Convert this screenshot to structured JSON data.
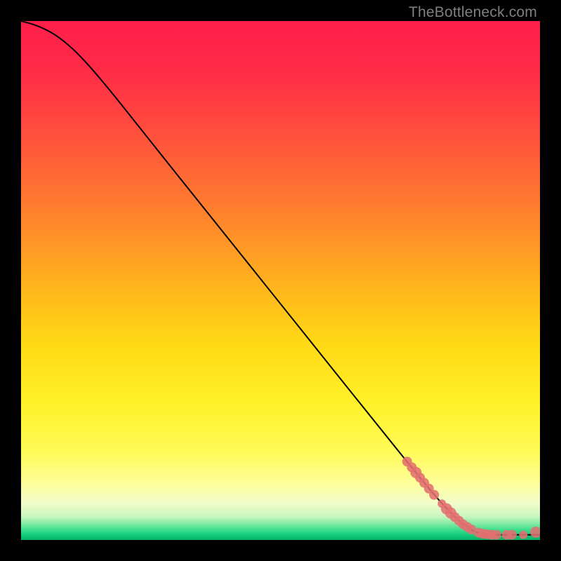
{
  "watermark": "TheBottleneck.com",
  "colors": {
    "point": "#e27070",
    "curve": "#000000",
    "gradient_stops": [
      {
        "offset": "0%",
        "color": "#ff1f4a"
      },
      {
        "offset": "9%",
        "color": "#ff2a47"
      },
      {
        "offset": "20%",
        "color": "#ff4a3e"
      },
      {
        "offset": "35%",
        "color": "#ff7a30"
      },
      {
        "offset": "50%",
        "color": "#ffb01e"
      },
      {
        "offset": "62%",
        "color": "#ffd915"
      },
      {
        "offset": "74%",
        "color": "#fff22a"
      },
      {
        "offset": "83%",
        "color": "#fffb58"
      },
      {
        "offset": "89%",
        "color": "#feff9a"
      },
      {
        "offset": "93%",
        "color": "#f1fcca"
      },
      {
        "offset": "95.5%",
        "color": "#c8f6c0"
      },
      {
        "offset": "97%",
        "color": "#7be9a0"
      },
      {
        "offset": "98.2%",
        "color": "#34dc8c"
      },
      {
        "offset": "99.2%",
        "color": "#10c878"
      },
      {
        "offset": "100%",
        "color": "#00b266"
      }
    ]
  },
  "chart_data": {
    "type": "line",
    "title": "",
    "xlabel": "",
    "ylabel": "",
    "xlim": [
      0,
      100
    ],
    "ylim": [
      0,
      100
    ],
    "series": [
      {
        "name": "curve",
        "kind": "line",
        "points": [
          {
            "x": 0.0,
            "y": 100.0
          },
          {
            "x": 3.0,
            "y": 99.2
          },
          {
            "x": 6.5,
            "y": 97.5
          },
          {
            "x": 10.0,
            "y": 94.7
          },
          {
            "x": 13.5,
            "y": 91.0
          },
          {
            "x": 18.0,
            "y": 85.6
          },
          {
            "x": 24.0,
            "y": 78.0
          },
          {
            "x": 32.0,
            "y": 68.0
          },
          {
            "x": 40.0,
            "y": 58.0
          },
          {
            "x": 50.0,
            "y": 45.5
          },
          {
            "x": 60.0,
            "y": 33.0
          },
          {
            "x": 70.0,
            "y": 20.5
          },
          {
            "x": 78.0,
            "y": 10.6
          },
          {
            "x": 82.0,
            "y": 6.0
          },
          {
            "x": 85.0,
            "y": 3.2
          },
          {
            "x": 87.0,
            "y": 1.8
          },
          {
            "x": 88.5,
            "y": 1.2
          },
          {
            "x": 90.0,
            "y": 1.0
          },
          {
            "x": 96.0,
            "y": 1.0
          },
          {
            "x": 100.0,
            "y": 1.0
          }
        ]
      },
      {
        "name": "highlight-points",
        "kind": "scatter",
        "points": [
          {
            "x": 74.4,
            "y": 15.1,
            "r": 7
          },
          {
            "x": 75.3,
            "y": 14.0,
            "r": 7
          },
          {
            "x": 76.1,
            "y": 13.0,
            "r": 8
          },
          {
            "x": 76.9,
            "y": 12.0,
            "r": 7
          },
          {
            "x": 77.7,
            "y": 11.0,
            "r": 7
          },
          {
            "x": 78.6,
            "y": 9.9,
            "r": 7
          },
          {
            "x": 79.6,
            "y": 8.7,
            "r": 7
          },
          {
            "x": 81.1,
            "y": 7.0,
            "r": 6
          },
          {
            "x": 82.0,
            "y": 6.0,
            "r": 8
          },
          {
            "x": 82.8,
            "y": 5.2,
            "r": 8
          },
          {
            "x": 83.6,
            "y": 4.4,
            "r": 7
          },
          {
            "x": 84.4,
            "y": 3.7,
            "r": 7
          },
          {
            "x": 85.2,
            "y": 3.0,
            "r": 7
          },
          {
            "x": 86.0,
            "y": 2.5,
            "r": 7
          },
          {
            "x": 86.8,
            "y": 2.0,
            "r": 7
          },
          {
            "x": 88.2,
            "y": 1.4,
            "r": 7
          },
          {
            "x": 89.0,
            "y": 1.2,
            "r": 7
          },
          {
            "x": 89.8,
            "y": 1.1,
            "r": 7
          },
          {
            "x": 90.7,
            "y": 1.0,
            "r": 7
          },
          {
            "x": 91.6,
            "y": 1.0,
            "r": 7
          },
          {
            "x": 93.6,
            "y": 1.0,
            "r": 7
          },
          {
            "x": 94.6,
            "y": 1.0,
            "r": 7
          },
          {
            "x": 96.8,
            "y": 1.0,
            "r": 6
          },
          {
            "x": 99.2,
            "y": 1.5,
            "r": 8
          }
        ]
      }
    ]
  }
}
